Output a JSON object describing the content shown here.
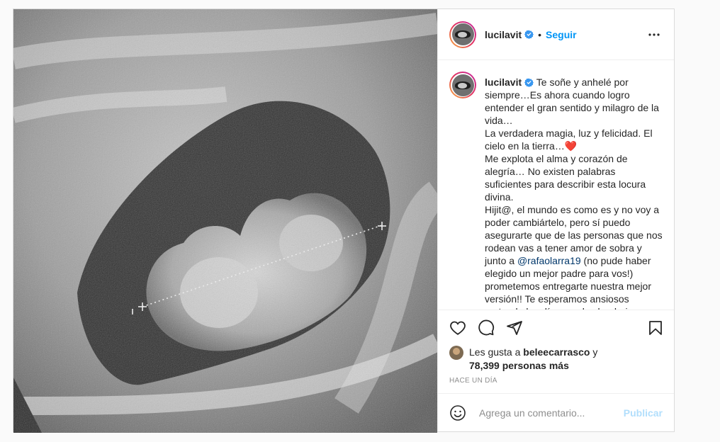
{
  "post": {
    "username": "lucilavit",
    "follow_label": "Seguir",
    "dot": "•",
    "caption": "Te soñe y anhelé por siempre…Es ahora cuando logro entender el gran sentido y milagro de la vida…\nLa verdadera magia, luz y felicidad. El cielo en la tierra…❤️\nMe explota el alma y corazón de alegría… No existen palabras suficientes para describir esta locura divina.\nHijit@, el mundo es como es y no voy a poder cambiártelo, pero sí puedo asegurarte que de las personas que nos rodean vas a tener amor de sobra y junto a ",
    "mention": "@rafaolarra19",
    "caption_after": " (no pude haber elegido un mejor padre para vos!) prometemos entregarte nuestra mejor versión!! Te esperamos ansiosos restando los días en el calendario para",
    "likes_prefix": "Les gusta a",
    "likes_user": "beleecarrasco",
    "likes_and": "y",
    "likes_count": "78,399 personas más",
    "time": "Hace un día",
    "comment_placeholder": "Agrega un comentario...",
    "publish_label": "Publicar"
  },
  "icons": {
    "verified": "verified-badge-icon",
    "more": "more-options-icon",
    "like": "heart-icon",
    "comment": "comment-bubble-icon",
    "share": "paper-plane-icon",
    "save": "bookmark-icon",
    "emoji": "emoji-icon"
  },
  "colors": {
    "accent": "#0095f6",
    "verified": "#3897f0",
    "text": "#262626",
    "muted": "#8e8e8e",
    "mention": "#00376b"
  }
}
